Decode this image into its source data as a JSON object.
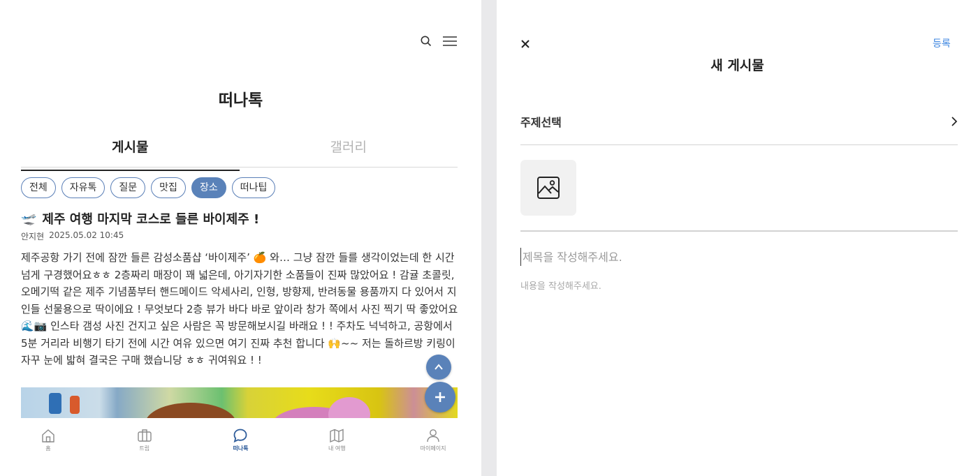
{
  "left": {
    "app_title": "떠나톡",
    "tabs": [
      {
        "label": "게시물",
        "active": true
      },
      {
        "label": "갤러리",
        "active": false
      }
    ],
    "chips": [
      {
        "label": "전체",
        "active": false
      },
      {
        "label": "자유톡",
        "active": false
      },
      {
        "label": "질문",
        "active": false
      },
      {
        "label": "맛집",
        "active": false
      },
      {
        "label": "장소",
        "active": true
      },
      {
        "label": "떠나팁",
        "active": false
      }
    ],
    "post": {
      "title_emoji": "🛫",
      "title": "제주 여행 마지막 코스로 들른 바이제주 !",
      "author": "안지현",
      "datetime": "2025.05.02 10:45",
      "body": "제주공항 가기 전에 잠깐 들른 감성소품샵 ‘바이제주’ 🍊 와… 그냥 잠깐 들를 생각이었는데 한 시간 넘게 구경했어요ㅎㅎ 2층짜리 매장이 꽤 넓은데, 아기자기한 소품들이 진짜 많았어요 ! 감귤 초콜릿, 오메기떡 같은 제주 기념품부터 핸드메이드 악세사리, 인형, 방향제, 반려동물 용품까지 다 있어서 지인들 선물용으로 딱이에요 ! 무엇보다 2층 뷰가 바다 바로 앞이라 창가 쪽에서 사진 찍기 딱 좋았어요 🌊📷 인스타 갬성 사진 건지고 싶은 사람은 꼭 방문해보시길 바래요 ! ! 주차도 넉넉하고, 공항에서 5분 거리라 비행기 타기 전에 시간 여유 있으면 여기 진짜 추천 합니다 🙌~~ 저는 돌하르방 키링이 자꾸 눈에 밟혀 결국은 구매 했습니당 ㅎㅎ 귀여워요 ! !"
    },
    "icons": {
      "search": "search-icon",
      "menu": "menu-icon",
      "scroll_top": "chevron-up-icon",
      "add": "plus-icon"
    },
    "nav": [
      {
        "label": "홈",
        "icon": "home-icon",
        "active": false
      },
      {
        "label": "트립",
        "icon": "suitcase-icon",
        "active": false
      },
      {
        "label": "떠나톡",
        "icon": "chat-bubble-icon",
        "active": true
      },
      {
        "label": "내 여행",
        "icon": "map-icon",
        "active": false
      },
      {
        "label": "마이페이지",
        "icon": "person-icon",
        "active": false
      }
    ],
    "accent_color": "#5a82b9"
  },
  "right": {
    "close_icon": "close-icon",
    "register_label": "등록",
    "title": "새 게시물",
    "topic_label": "주제선택",
    "image_upload_icon": "image-icon",
    "title_placeholder": "제목을 작성해주세요.",
    "content_placeholder": "내용을 작성해주세요.",
    "link_color": "#3d86e0"
  }
}
